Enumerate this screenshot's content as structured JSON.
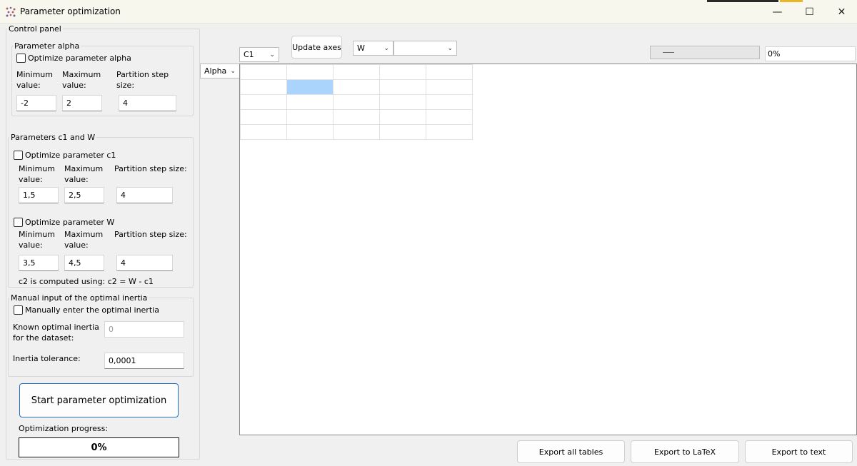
{
  "window": {
    "title": "Parameter optimization",
    "minimize_glyph": "—",
    "maximize_glyph": "☐",
    "close_glyph": "✕"
  },
  "control_panel": {
    "legend": "Control panel",
    "alpha": {
      "legend": "Parameter alpha",
      "checkbox_label": "Optimize parameter alpha",
      "checked": false,
      "min_label": "Minimum value:",
      "max_label": "Maximum value:",
      "step_label": "Partition step size:",
      "min_value": "-2",
      "max_value": "2",
      "step_value": "4"
    },
    "c1w": {
      "legend": "Parameters c1 and W",
      "c1_checkbox_label": "Optimize parameter c1",
      "c1_checked": false,
      "c1_min_label": "Minimum value:",
      "c1_max_label": "Maximum value:",
      "c1_step_label": "Partition step size:",
      "c1_min_value": "1,5",
      "c1_max_value": "2,5",
      "c1_step_value": "4",
      "w_checkbox_label": "Optimize parameter W",
      "w_checked": false,
      "w_min_label": "Minimum value:",
      "w_max_label": "Maximum value:",
      "w_step_label": "Partition step size:",
      "w_min_value": "3,5",
      "w_max_value": "4,5",
      "w_step_value": "4",
      "note": "c2 is computed using: c2 = W - c1"
    },
    "manual": {
      "legend": "Manual input of the optimal inertia",
      "checkbox_label": "Manually enter the optimal inertia",
      "checked": false,
      "known_label": "Known optimal inertia for the dataset:",
      "known_value": "0",
      "tolerance_label": "Inertia tolerance:",
      "tolerance_value": "0,0001"
    },
    "start_button": "Start parameter optimization",
    "progress_label": "Optimization progress:",
    "progress_value": "0%",
    "progress_fraction": 0
  },
  "toolbar": {
    "axis_x_combo": "C1",
    "update_axes_button": "Update axes",
    "axis_w_combo": "W",
    "axis_w_value_combo": "",
    "row_axis_combo": "Alpha",
    "top_progress_value": "0%",
    "top_progress_fraction": 0
  },
  "footer": {
    "export_all": "Export all tables",
    "export_latex": "Export to LaTeX",
    "export_text": "Export to text"
  },
  "colors": {
    "selected_cell": "#aad4fb",
    "button_border_accent": "#1f6fc4"
  },
  "icons": {
    "app": "app-icon",
    "chevron": "chevron-down-icon",
    "minimize": "minimize-icon",
    "maximize": "maximize-icon",
    "close": "close-icon"
  }
}
